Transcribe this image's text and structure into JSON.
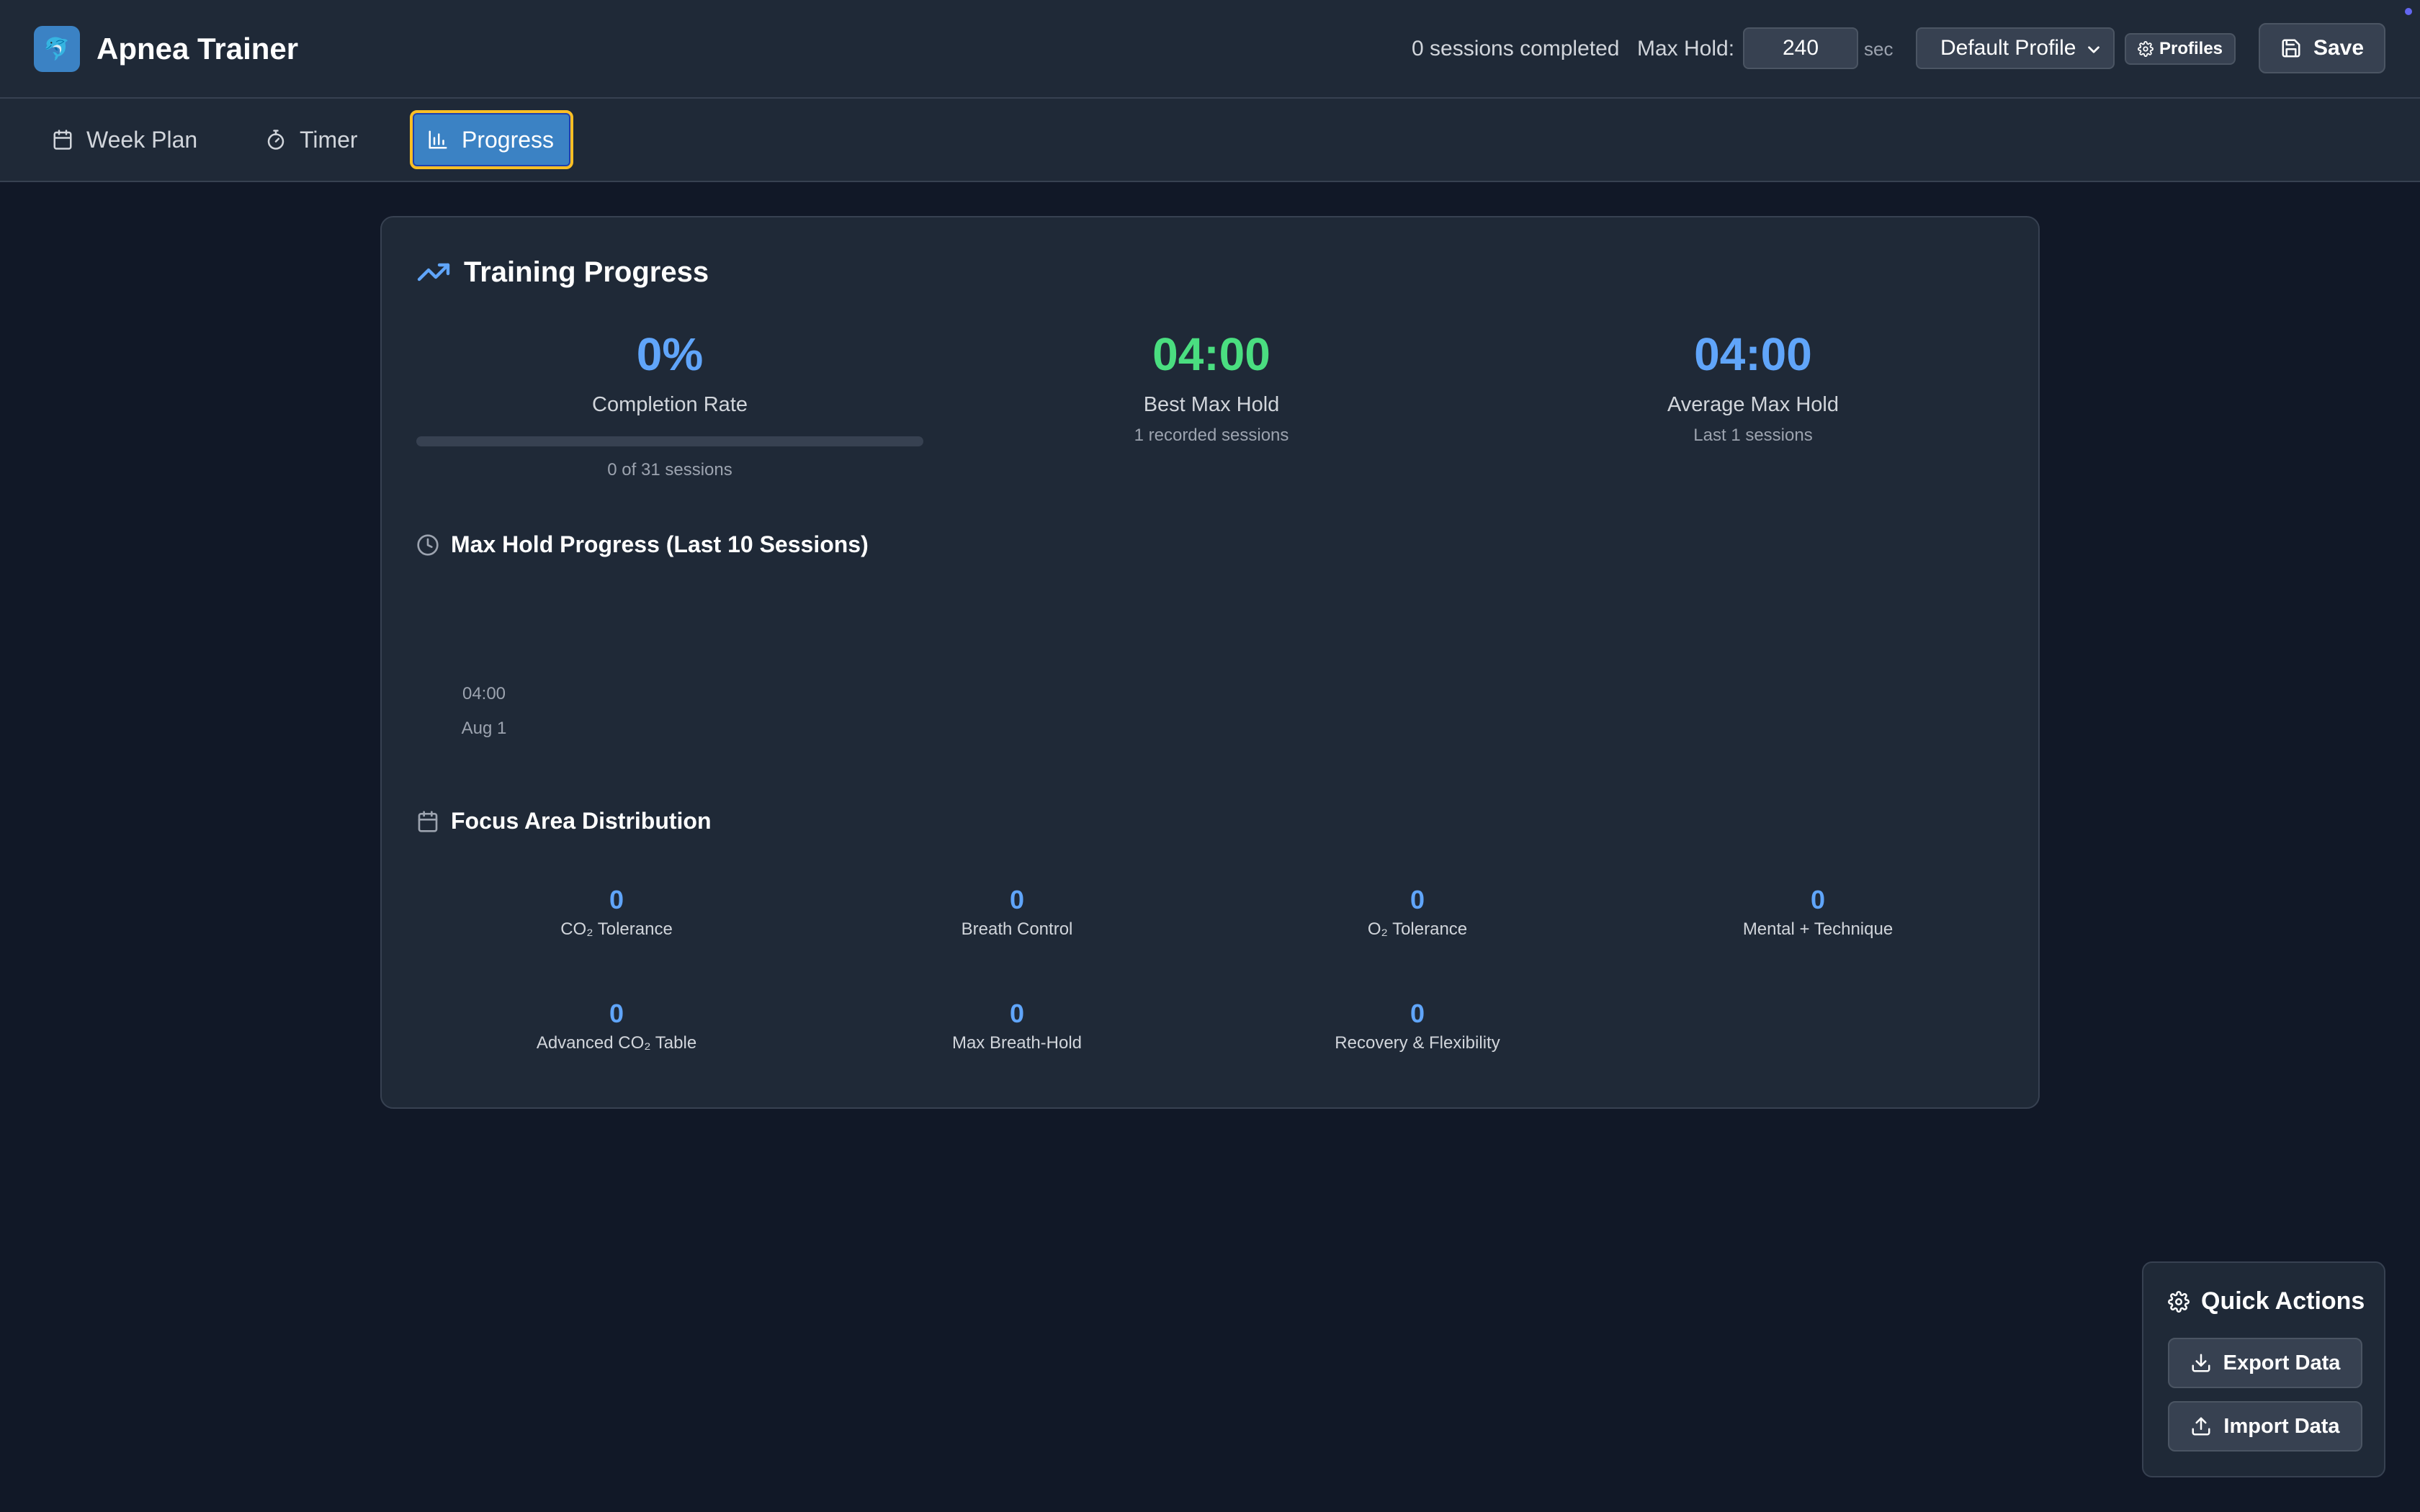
{
  "header": {
    "logo_glyph": "🐬",
    "app_title": "Apnea Trainer",
    "sessions_completed": "0 sessions completed",
    "max_hold_label": "Max Hold:",
    "max_hold_value": "240",
    "max_hold_unit": "sec",
    "profile_selected": "Default Profile",
    "profiles_button": "Profiles",
    "save_button": "Save"
  },
  "tabs": [
    {
      "label": "Week Plan",
      "icon": "calendar-icon",
      "active": false
    },
    {
      "label": "Timer",
      "icon": "stopwatch-icon",
      "active": false
    },
    {
      "label": "Progress",
      "icon": "bar-chart-icon",
      "active": true
    }
  ],
  "progress": {
    "title": "Training Progress",
    "stats": {
      "completion": {
        "value": "0%",
        "label": "Completion Rate",
        "sub": "0 of 31 sessions",
        "fraction": 0
      },
      "best": {
        "value": "04:00",
        "label": "Best Max Hold",
        "sub": "1 recorded sessions"
      },
      "average": {
        "value": "04:00",
        "label": "Average Max Hold",
        "sub": "Last 1 sessions"
      }
    },
    "hold_chart": {
      "title": "Max Hold Progress (Last 10 Sessions)",
      "entries": [
        {
          "value": "04:00",
          "date": "Aug 1"
        }
      ]
    },
    "focus": {
      "title": "Focus Area Distribution",
      "items": [
        {
          "count": "0",
          "label": "CO₂ Tolerance"
        },
        {
          "count": "0",
          "label": "Breath Control"
        },
        {
          "count": "0",
          "label": "O₂ Tolerance"
        },
        {
          "count": "0",
          "label": "Mental + Technique"
        },
        {
          "count": "0",
          "label": "Advanced CO₂ Table"
        },
        {
          "count": "0",
          "label": "Max Breath-Hold"
        },
        {
          "count": "0",
          "label": "Recovery & Flexibility"
        }
      ]
    }
  },
  "quick_actions": {
    "title": "Quick Actions",
    "export": "Export Data",
    "import": "Import Data"
  },
  "colors": {
    "background": "#111827",
    "panel": "#1f2937",
    "accent_blue": "#60a5fa",
    "accent_green": "#4ade80",
    "active_tab": "#3b82c4",
    "focus_ring": "#fbbf24"
  }
}
